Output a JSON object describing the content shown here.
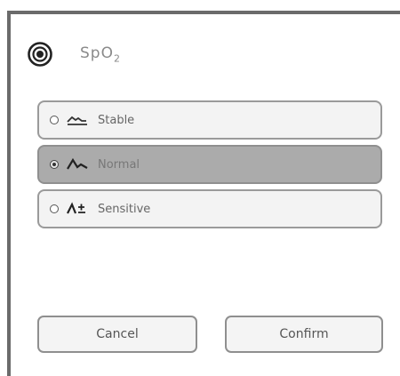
{
  "window": {
    "title": "SpO",
    "title_subscript": "2"
  },
  "header": {
    "icon": "spo2-target-icon"
  },
  "options": [
    {
      "label": "Stable",
      "icon": "stable-wave-icon",
      "selected": false
    },
    {
      "label": "Normal",
      "icon": "normal-wave-icon",
      "selected": true
    },
    {
      "label": "Sensitive",
      "icon": "sensitive-wave-icon",
      "selected": false
    }
  ],
  "buttons": {
    "cancel_label": "Cancel",
    "confirm_label": "Confirm"
  },
  "colors": {
    "selected_bg": "#ababab",
    "option_bg": "#f3f3f3",
    "frame": "#6b6b6b"
  }
}
